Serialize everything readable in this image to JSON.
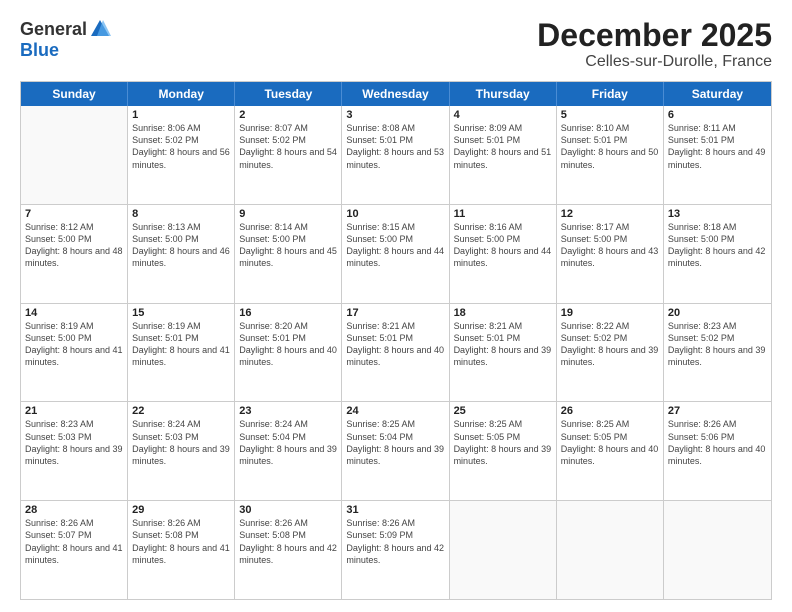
{
  "logo": {
    "general": "General",
    "blue": "Blue"
  },
  "title": "December 2025",
  "location": "Celles-sur-Durolle, France",
  "header_days": [
    "Sunday",
    "Monday",
    "Tuesday",
    "Wednesday",
    "Thursday",
    "Friday",
    "Saturday"
  ],
  "rows": [
    [
      {
        "day": "",
        "empty": true
      },
      {
        "day": "1",
        "sunrise": "8:06 AM",
        "sunset": "5:02 PM",
        "daylight": "8 hours and 56 minutes."
      },
      {
        "day": "2",
        "sunrise": "8:07 AM",
        "sunset": "5:02 PM",
        "daylight": "8 hours and 54 minutes."
      },
      {
        "day": "3",
        "sunrise": "8:08 AM",
        "sunset": "5:01 PM",
        "daylight": "8 hours and 53 minutes."
      },
      {
        "day": "4",
        "sunrise": "8:09 AM",
        "sunset": "5:01 PM",
        "daylight": "8 hours and 51 minutes."
      },
      {
        "day": "5",
        "sunrise": "8:10 AM",
        "sunset": "5:01 PM",
        "daylight": "8 hours and 50 minutes."
      },
      {
        "day": "6",
        "sunrise": "8:11 AM",
        "sunset": "5:01 PM",
        "daylight": "8 hours and 49 minutes."
      }
    ],
    [
      {
        "day": "7",
        "sunrise": "8:12 AM",
        "sunset": "5:00 PM",
        "daylight": "8 hours and 48 minutes."
      },
      {
        "day": "8",
        "sunrise": "8:13 AM",
        "sunset": "5:00 PM",
        "daylight": "8 hours and 46 minutes."
      },
      {
        "day": "9",
        "sunrise": "8:14 AM",
        "sunset": "5:00 PM",
        "daylight": "8 hours and 45 minutes."
      },
      {
        "day": "10",
        "sunrise": "8:15 AM",
        "sunset": "5:00 PM",
        "daylight": "8 hours and 44 minutes."
      },
      {
        "day": "11",
        "sunrise": "8:16 AM",
        "sunset": "5:00 PM",
        "daylight": "8 hours and 44 minutes."
      },
      {
        "day": "12",
        "sunrise": "8:17 AM",
        "sunset": "5:00 PM",
        "daylight": "8 hours and 43 minutes."
      },
      {
        "day": "13",
        "sunrise": "8:18 AM",
        "sunset": "5:00 PM",
        "daylight": "8 hours and 42 minutes."
      }
    ],
    [
      {
        "day": "14",
        "sunrise": "8:19 AM",
        "sunset": "5:00 PM",
        "daylight": "8 hours and 41 minutes."
      },
      {
        "day": "15",
        "sunrise": "8:19 AM",
        "sunset": "5:01 PM",
        "daylight": "8 hours and 41 minutes."
      },
      {
        "day": "16",
        "sunrise": "8:20 AM",
        "sunset": "5:01 PM",
        "daylight": "8 hours and 40 minutes."
      },
      {
        "day": "17",
        "sunrise": "8:21 AM",
        "sunset": "5:01 PM",
        "daylight": "8 hours and 40 minutes."
      },
      {
        "day": "18",
        "sunrise": "8:21 AM",
        "sunset": "5:01 PM",
        "daylight": "8 hours and 39 minutes."
      },
      {
        "day": "19",
        "sunrise": "8:22 AM",
        "sunset": "5:02 PM",
        "daylight": "8 hours and 39 minutes."
      },
      {
        "day": "20",
        "sunrise": "8:23 AM",
        "sunset": "5:02 PM",
        "daylight": "8 hours and 39 minutes."
      }
    ],
    [
      {
        "day": "21",
        "sunrise": "8:23 AM",
        "sunset": "5:03 PM",
        "daylight": "8 hours and 39 minutes."
      },
      {
        "day": "22",
        "sunrise": "8:24 AM",
        "sunset": "5:03 PM",
        "daylight": "8 hours and 39 minutes."
      },
      {
        "day": "23",
        "sunrise": "8:24 AM",
        "sunset": "5:04 PM",
        "daylight": "8 hours and 39 minutes."
      },
      {
        "day": "24",
        "sunrise": "8:25 AM",
        "sunset": "5:04 PM",
        "daylight": "8 hours and 39 minutes."
      },
      {
        "day": "25",
        "sunrise": "8:25 AM",
        "sunset": "5:05 PM",
        "daylight": "8 hours and 39 minutes."
      },
      {
        "day": "26",
        "sunrise": "8:25 AM",
        "sunset": "5:05 PM",
        "daylight": "8 hours and 40 minutes."
      },
      {
        "day": "27",
        "sunrise": "8:26 AM",
        "sunset": "5:06 PM",
        "daylight": "8 hours and 40 minutes."
      }
    ],
    [
      {
        "day": "28",
        "sunrise": "8:26 AM",
        "sunset": "5:07 PM",
        "daylight": "8 hours and 41 minutes."
      },
      {
        "day": "29",
        "sunrise": "8:26 AM",
        "sunset": "5:08 PM",
        "daylight": "8 hours and 41 minutes."
      },
      {
        "day": "30",
        "sunrise": "8:26 AM",
        "sunset": "5:08 PM",
        "daylight": "8 hours and 42 minutes."
      },
      {
        "day": "31",
        "sunrise": "8:26 AM",
        "sunset": "5:09 PM",
        "daylight": "8 hours and 42 minutes."
      },
      {
        "day": "",
        "empty": true
      },
      {
        "day": "",
        "empty": true
      },
      {
        "day": "",
        "empty": true
      }
    ]
  ]
}
